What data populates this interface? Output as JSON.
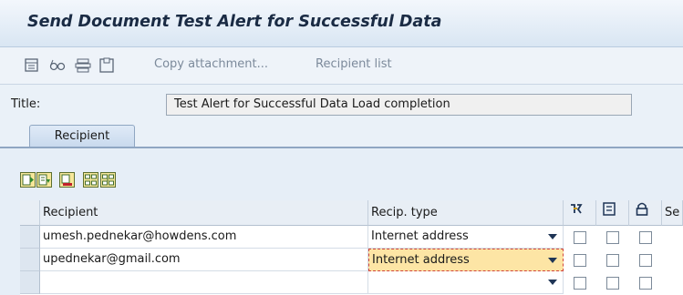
{
  "window": {
    "title": "Send Document Test Alert for Successful Data"
  },
  "toolbar": {
    "icons": [
      "document-icon",
      "glasses-icon",
      "stack-icon",
      "frame-icon"
    ],
    "copy_attachment_label": "Copy attachment...",
    "recipient_list_label": "Recipient list"
  },
  "form": {
    "title_label": "Title:",
    "title_value": "Test Alert for Successful Data Load completion"
  },
  "tabs": [
    {
      "label": "Recipient",
      "active": true
    }
  ],
  "grid": {
    "toolbar_icons": [
      "insert-row-icon",
      "append-row-icon",
      "delete-row-icon",
      "sort-ascending-icon",
      "sort-descending-icon"
    ],
    "columns": {
      "recipient": "Recipient",
      "recip_type": "Recip. type",
      "col_se": "Se"
    },
    "header_icons": [
      "express-icon",
      "copy-icon",
      "lock-icon"
    ],
    "rows": [
      {
        "recipient": "umesh.pednekar@howdens.com",
        "recip_type": "Internet address"
      },
      {
        "recipient": "upednekar@gmail.com",
        "recip_type": "Internet address"
      },
      {
        "recipient": "",
        "recip_type": ""
      }
    ]
  },
  "colors": {
    "highlight": "#fde5a5",
    "title_text": "#1a2b44",
    "accent_border": "#8fa6c2"
  }
}
